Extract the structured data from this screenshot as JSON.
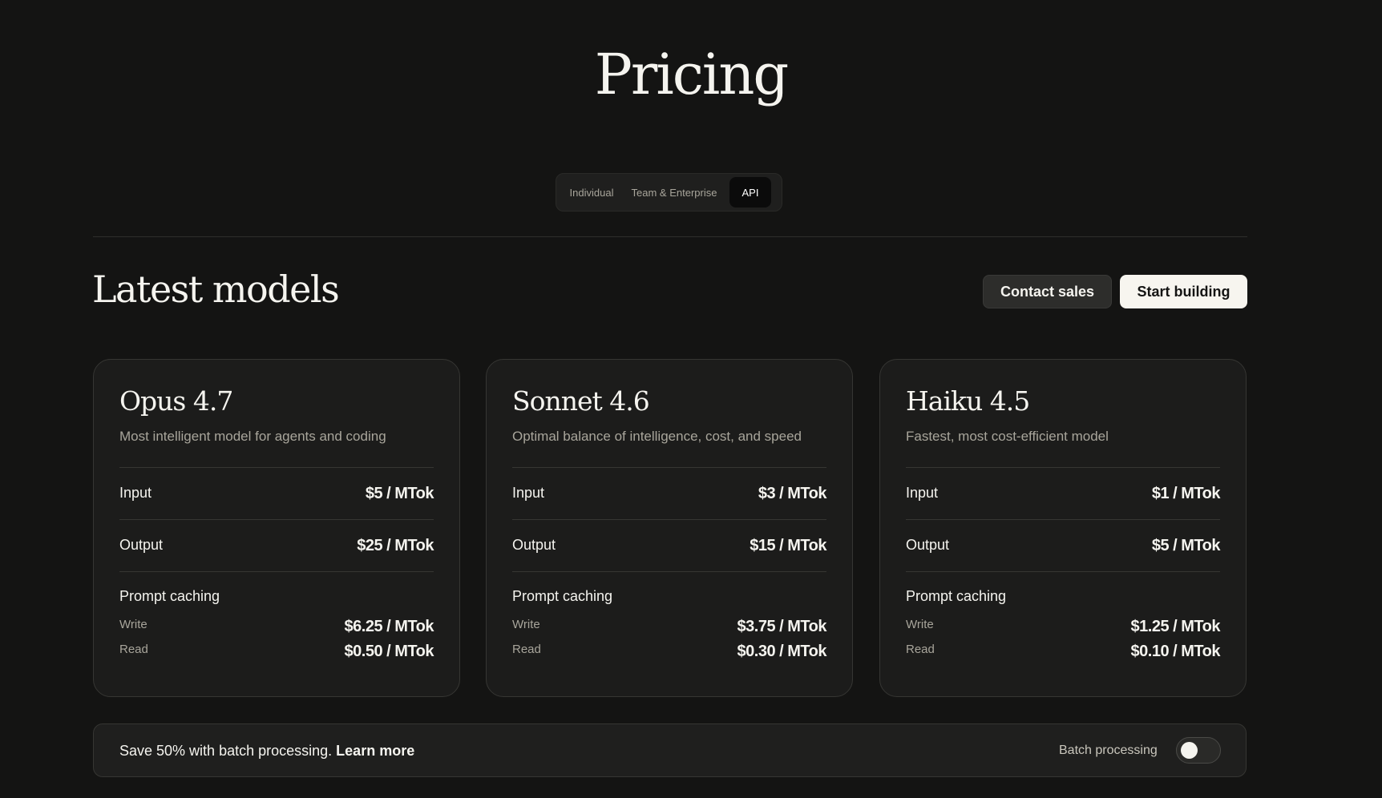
{
  "header": {
    "title": "Pricing"
  },
  "tabs": [
    {
      "label": "Individual",
      "active": false
    },
    {
      "label": "Team & Enterprise",
      "active": false
    },
    {
      "label": "API",
      "active": true
    }
  ],
  "section": {
    "title": "Latest models",
    "contact_label": "Contact sales",
    "start_label": "Start building"
  },
  "models": [
    {
      "name": "Opus 4.7",
      "description": "Most intelligent model for agents and coding",
      "input_label": "Input",
      "input_price": "$5 / MTok",
      "output_label": "Output",
      "output_price": "$25 / MTok",
      "caching_label": "Prompt caching",
      "write_label": "Write",
      "write_price": "$6.25 / MTok",
      "read_label": "Read",
      "read_price": "$0.50 / MTok"
    },
    {
      "name": "Sonnet 4.6",
      "description": "Optimal balance of intelligence, cost, and speed",
      "input_label": "Input",
      "input_price": "$3 / MTok",
      "output_label": "Output",
      "output_price": "$15 / MTok",
      "caching_label": "Prompt caching",
      "write_label": "Write",
      "write_price": "$3.75 / MTok",
      "read_label": "Read",
      "read_price": "$0.30 / MTok"
    },
    {
      "name": "Haiku 4.5",
      "description": "Fastest, most cost-efficient model",
      "input_label": "Input",
      "input_price": "$1 / MTok",
      "output_label": "Output",
      "output_price": "$5 / MTok",
      "caching_label": "Prompt caching",
      "write_label": "Write",
      "write_price": "$1.25 / MTok",
      "read_label": "Read",
      "read_price": "$0.10 / MTok"
    }
  ],
  "batch": {
    "text": "Save 50% with batch processing.",
    "link_label": "Learn more",
    "toggle_label": "Batch processing",
    "toggle_on": false
  },
  "colors": {
    "background": "#141413",
    "card_background": "#1c1c1b",
    "text_primary": "#f5f4ef",
    "text_muted": "#a8a59b",
    "button_light": "#f7f5ef"
  }
}
